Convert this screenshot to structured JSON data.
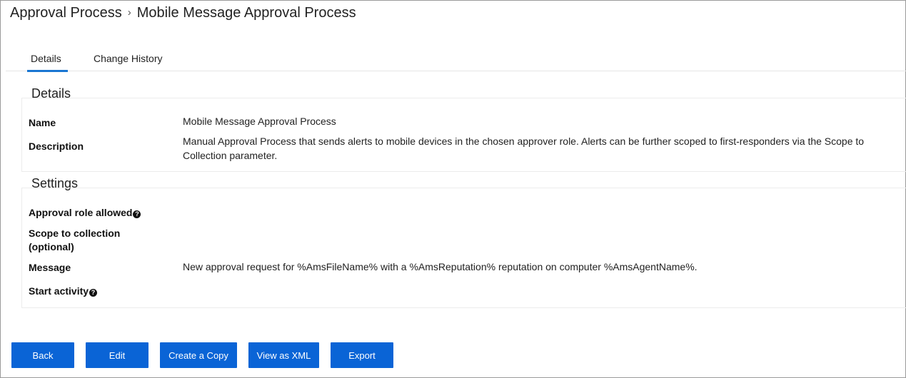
{
  "breadcrumb": {
    "parent": "Approval Process",
    "separator": "›",
    "current": "Mobile Message Approval Process"
  },
  "tabs": [
    {
      "label": "Details",
      "active": true
    },
    {
      "label": "Change History",
      "active": false
    }
  ],
  "details": {
    "title": "Details",
    "name_label": "Name",
    "name_value": "Mobile Message Approval Process",
    "description_label": "Description",
    "description_value": "Manual Approval Process that sends alerts to mobile devices in the chosen approver role. Alerts can be further scoped to first-responders via the Scope to Collection parameter."
  },
  "settings": {
    "title": "Settings",
    "approval_role_label": "Approval role allowed",
    "scope_label_line1": "Scope to collection",
    "scope_label_line2": "(optional)",
    "message_label": "Message",
    "message_value": "New approval request for %AmsFileName% with a %AmsReputation% reputation on computer %AmsAgentName%.",
    "start_activity_label": "Start activity",
    "help_glyph": "?"
  },
  "buttons": {
    "back": "Back",
    "edit": "Edit",
    "create_copy": "Create a Copy",
    "view_xml": "View as XML",
    "export": "Export"
  },
  "colors": {
    "accent": "#1976d2",
    "button": "#0a64d6"
  }
}
